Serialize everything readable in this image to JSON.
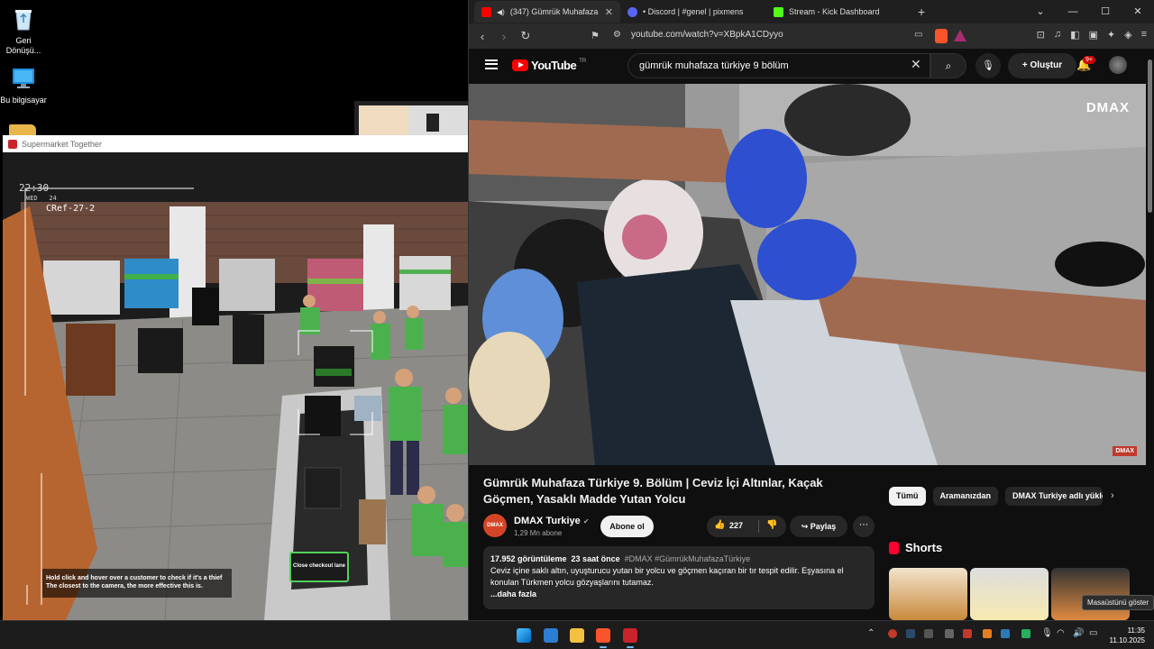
{
  "desktop": {
    "icons": [
      {
        "label": "Geri Dönüşü...",
        "icon": "recycle-bin-icon"
      },
      {
        "label": "Bu bilgisayar",
        "icon": "monitor-icon"
      }
    ]
  },
  "game": {
    "window_title": "Supermarket Together",
    "hud": {
      "time": "22:30",
      "day": "WED",
      "day_num": "24",
      "camera_id": "CRef-27-2"
    },
    "hint": {
      "line1": "Hold click and hover over a customer to check if it's a thief",
      "line2": "The closest to the camera, the more effective this is."
    },
    "checkout_label": "Close checkout lane"
  },
  "browser": {
    "tabs": [
      {
        "label": "(347) Gümrük Muhafaza Türkiye",
        "icon": "youtube-icon",
        "active": true
      },
      {
        "label": "• Discord | #genel | pixmens",
        "icon": "discord-icon",
        "active": false
      },
      {
        "label": "Stream - Kick Dashboard",
        "icon": "kick-icon",
        "active": false
      }
    ],
    "new_tab": "+",
    "url": "youtube.com/watch?v=XBpkA1CDyyo"
  },
  "youtube": {
    "logo": "YouTube",
    "region": "TR",
    "search_value": "gümrük muhafaza türkiye 9 bölüm",
    "create_label": "Oluştur",
    "notification_count": "9+",
    "video": {
      "watermark": "DMAX",
      "corner_logo": "DMAX",
      "title": "Gümrük Muhafaza Türkiye 9. Bölüm | Ceviz İçi Altınlar, Kaçak Göçmen, Yasaklı Madde Yutan Yolcu",
      "channel_name": "DMAX Turkiye",
      "channel_avatar": "DMAX",
      "subscribers": "1,29 Mn abone",
      "subscribe_label": "Abone ol",
      "likes": "227",
      "share_label": "Paylaş",
      "views": "17.952 görüntüleme",
      "age": "23 saat önce",
      "tags": "#DMAX #GümrükMuhafazaTürkiye",
      "description": "Ceviz içine saklı altın, uyuşturucu yutan bir yolcu ve göçmen kaçıran bir tır tespit edilir. Eşyasına el konulan Türkmen yolcu gözyaşlarını tutamaz.",
      "more_label": "...daha fazla"
    },
    "chips": [
      "Tümü",
      "Aramanızdan",
      "DMAX Turkiye adlı yükle"
    ],
    "shorts_title": "Shorts"
  },
  "tooltip": "Masaüstünü göster",
  "taskbar": {
    "time": "11:35",
    "date": "11.10.2025"
  }
}
